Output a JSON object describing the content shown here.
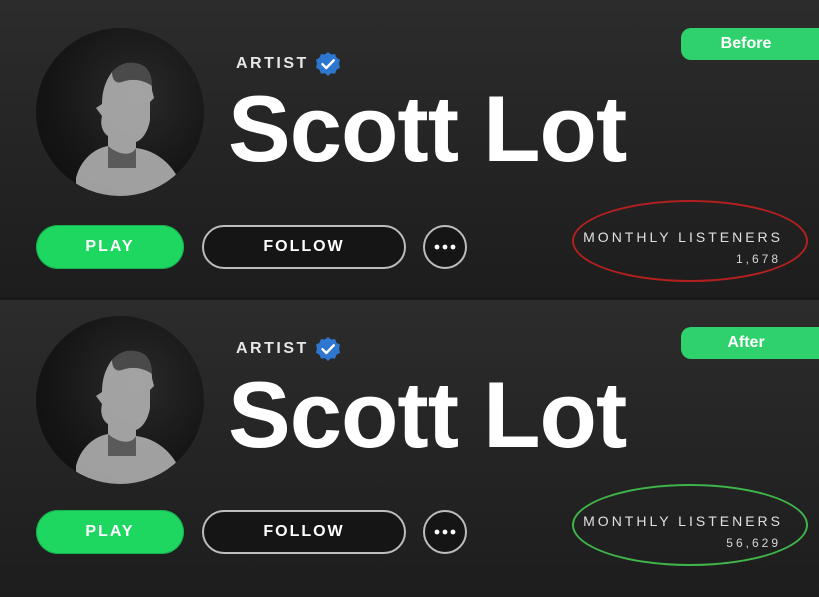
{
  "panels": [
    {
      "tag_label": "Before",
      "artist_label": "ARTIST",
      "artist_name": "Scott Lot",
      "play_label": "PLAY",
      "follow_label": "FOLLOW",
      "listeners_label": "MONTHLY LISTENERS",
      "listeners_count": "1,678",
      "highlight_color": "#b3201f"
    },
    {
      "tag_label": "After",
      "artist_label": "ARTIST",
      "artist_name": "Scott Lot",
      "play_label": "PLAY",
      "follow_label": "FOLLOW",
      "listeners_label": "MONTHLY LISTENERS",
      "listeners_count": "56,629",
      "highlight_color": "#3fb54a"
    }
  ],
  "colors": {
    "spotify_green": "#1ed760",
    "tag_green": "#2ed16c",
    "verified_blue": "#2e77d0",
    "background": "#242424"
  },
  "icons": {
    "verified": "verified-check-icon",
    "more": "more-options-icon",
    "avatar": "artist-photo"
  }
}
